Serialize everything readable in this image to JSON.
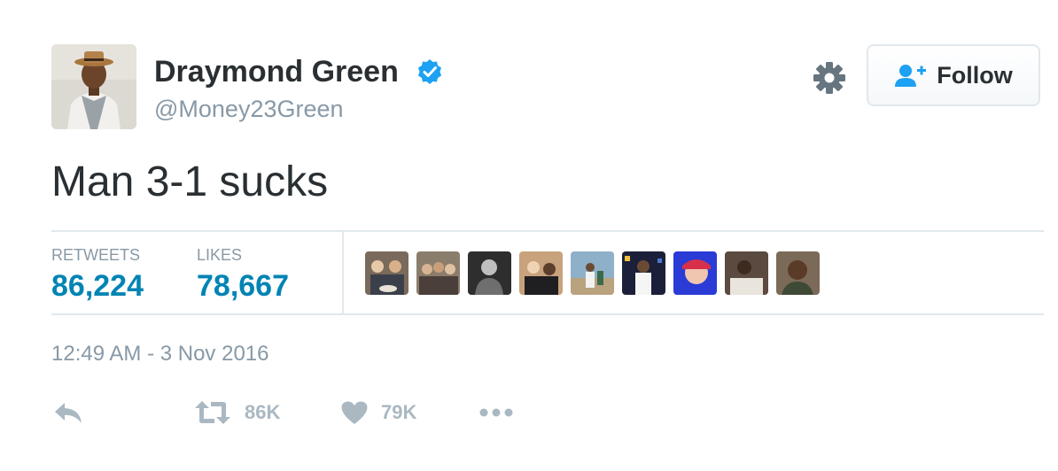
{
  "user": {
    "name": "Draymond Green",
    "handle": "@Money23Green",
    "verified": true
  },
  "follow_button": {
    "label": "Follow"
  },
  "tweet": {
    "text": "Man 3-1 sucks",
    "timestamp": "12:49 AM - 3 Nov 2016"
  },
  "stats": {
    "retweets_label": "RETWEETS",
    "retweets_value": "86,224",
    "likes_label": "LIKES",
    "likes_value": "78,667"
  },
  "liker_avatar_count": 9,
  "actions": {
    "retweet_count": "86K",
    "like_count": "79K"
  },
  "colors": {
    "link_blue": "#0084b4",
    "verified_blue": "#1da1f2",
    "muted_gray": "#8899a6",
    "action_gray": "#aab8c2",
    "border": "#e1e8ed"
  },
  "icons": {
    "verified": "verified-badge-icon",
    "settings": "gear-icon",
    "follow": "add-user-icon",
    "reply": "reply-icon",
    "retweet": "retweet-icon",
    "like": "heart-icon",
    "more": "more-dots-icon"
  }
}
